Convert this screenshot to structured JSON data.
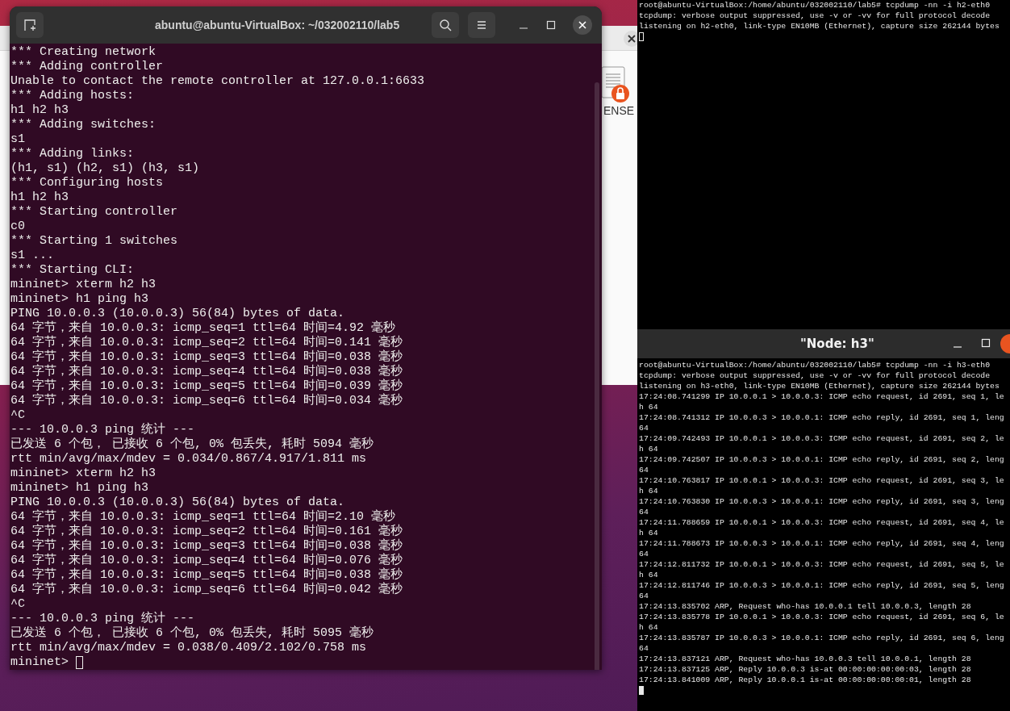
{
  "background_window": {
    "file_label": "ENSE"
  },
  "terminal": {
    "title": "abuntu@abuntu-VirtualBox: ~/032002110/lab5",
    "lines": [
      "*** Creating network",
      "*** Adding controller",
      "Unable to contact the remote controller at 127.0.0.1:6633",
      "*** Adding hosts:",
      "h1 h2 h3",
      "*** Adding switches:",
      "s1",
      "*** Adding links:",
      "(h1, s1) (h2, s1) (h3, s1)",
      "*** Configuring hosts",
      "h1 h2 h3",
      "*** Starting controller",
      "c0",
      "*** Starting 1 switches",
      "s1 ...",
      "*** Starting CLI:",
      "mininet> xterm h2 h3",
      "mininet> h1 ping h3",
      "PING 10.0.0.3 (10.0.0.3) 56(84) bytes of data.",
      "64 字节，来自 10.0.0.3: icmp_seq=1 ttl=64 时间=4.92 毫秒",
      "64 字节，来自 10.0.0.3: icmp_seq=2 ttl=64 时间=0.141 毫秒",
      "64 字节，来自 10.0.0.3: icmp_seq=3 ttl=64 时间=0.038 毫秒",
      "64 字节，来自 10.0.0.3: icmp_seq=4 ttl=64 时间=0.038 毫秒",
      "64 字节，来自 10.0.0.3: icmp_seq=5 ttl=64 时间=0.039 毫秒",
      "64 字节，来自 10.0.0.3: icmp_seq=6 ttl=64 时间=0.034 毫秒",
      "^C",
      "--- 10.0.0.3 ping 统计 ---",
      "已发送 6 个包， 已接收 6 个包, 0% 包丢失, 耗时 5094 毫秒",
      "rtt min/avg/max/mdev = 0.034/0.867/4.917/1.811 ms",
      "mininet> xterm h2 h3",
      "mininet> h1 ping h3",
      "PING 10.0.0.3 (10.0.0.3) 56(84) bytes of data.",
      "64 字节，来自 10.0.0.3: icmp_seq=1 ttl=64 时间=2.10 毫秒",
      "64 字节，来自 10.0.0.3: icmp_seq=2 ttl=64 时间=0.161 毫秒",
      "64 字节，来自 10.0.0.3: icmp_seq=3 ttl=64 时间=0.038 毫秒",
      "64 字节，来自 10.0.0.3: icmp_seq=4 ttl=64 时间=0.076 毫秒",
      "64 字节，来自 10.0.0.3: icmp_seq=5 ttl=64 时间=0.038 毫秒",
      "64 字节，来自 10.0.0.3: icmp_seq=6 ttl=64 时间=0.042 毫秒",
      "^C",
      "--- 10.0.0.3 ping 统计 ---",
      "已发送 6 个包， 已接收 6 个包, 0% 包丢失, 耗时 5095 毫秒",
      "rtt min/avg/max/mdev = 0.038/0.409/2.102/0.758 ms",
      "mininet>"
    ]
  },
  "xterm_h2": {
    "lines": [
      "root@abuntu-VirtualBox:/home/abuntu/032002110/lab5# tcpdump -nn -i h2-eth0",
      "tcpdump: verbose output suppressed, use -v or -vv for full protocol decode",
      "listening on h2-eth0, link-type EN10MB (Ethernet), capture size 262144 bytes"
    ]
  },
  "xterm_h3": {
    "title": "\"Node: h3\"",
    "lines": [
      "root@abuntu-VirtualBox:/home/abuntu/032002110/lab5# tcpdump -nn -i h3-eth0",
      "tcpdump: verbose output suppressed, use -v or -vv for full protocol decode",
      "listening on h3-eth0, link-type EN10MB (Ethernet), capture size 262144 bytes",
      "17:24:08.741299 IP 10.0.0.1 > 10.0.0.3: ICMP echo request, id 2691, seq 1, le",
      "h 64",
      "17:24:08.741312 IP 10.0.0.3 > 10.0.0.1: ICMP echo reply, id 2691, seq 1, leng",
      "64",
      "17:24:09.742493 IP 10.0.0.1 > 10.0.0.3: ICMP echo request, id 2691, seq 2, le",
      "h 64",
      "17:24:09.742507 IP 10.0.0.3 > 10.0.0.1: ICMP echo reply, id 2691, seq 2, leng",
      "64",
      "17:24:10.763817 IP 10.0.0.1 > 10.0.0.3: ICMP echo request, id 2691, seq 3, le",
      "h 64",
      "17:24:10.763830 IP 10.0.0.3 > 10.0.0.1: ICMP echo reply, id 2691, seq 3, leng",
      "64",
      "17:24:11.788659 IP 10.0.0.1 > 10.0.0.3: ICMP echo request, id 2691, seq 4, le",
      "h 64",
      "17:24:11.788673 IP 10.0.0.3 > 10.0.0.1: ICMP echo reply, id 2691, seq 4, leng",
      "64",
      "17:24:12.811732 IP 10.0.0.1 > 10.0.0.3: ICMP echo request, id 2691, seq 5, le",
      "h 64",
      "17:24:12.811746 IP 10.0.0.3 > 10.0.0.1: ICMP echo reply, id 2691, seq 5, leng",
      "64",
      "17:24:13.835702 ARP, Request who-has 10.0.0.1 tell 10.0.0.3, length 28",
      "17:24:13.835778 IP 10.0.0.1 > 10.0.0.3: ICMP echo request, id 2691, seq 6, le",
      "h 64",
      "17:24:13.835787 IP 10.0.0.3 > 10.0.0.1: ICMP echo reply, id 2691, seq 6, leng",
      "64",
      "17:24:13.837121 ARP, Request who-has 10.0.0.3 tell 10.0.0.1, length 28",
      "17:24:13.837125 ARP, Reply 10.0.0.3 is-at 00:00:00:00:00:03, length 28",
      "17:24:13.841009 ARP, Reply 10.0.0.1 is-at 00:00:00:00:00:01, length 28"
    ]
  }
}
